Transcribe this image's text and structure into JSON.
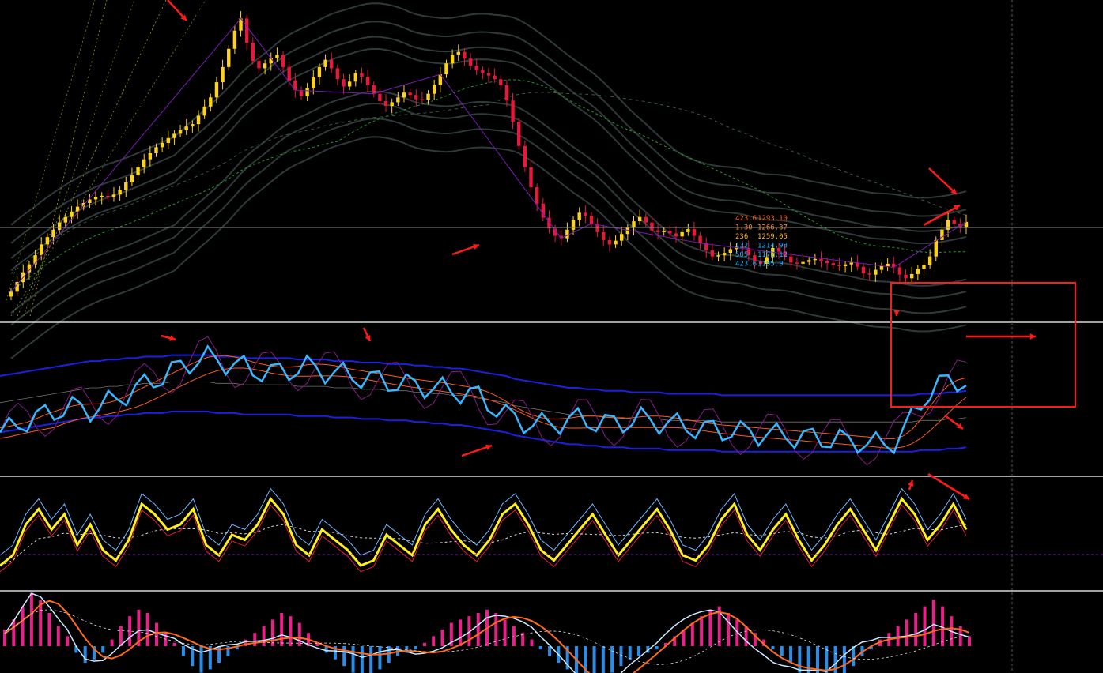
{
  "colors": {
    "background": "#000000",
    "bull_candle": "#ffd21a",
    "bear_candle": "#e8183c",
    "envelope": "#2e3a3a",
    "mid_dash": "#1e9a2a",
    "panel_divider": "#d8d8d8",
    "crosshair": "#9a9a9a",
    "rsi_main": "#38b6ff",
    "rsi_band": "#1a20e0",
    "rsi_slow": "#ff5a1a",
    "kd_main": "#ffef1a",
    "macd_pos": "#e8208a",
    "macd_neg": "#2a8ee8",
    "annotation": "#ff1a1a",
    "zigzag": "#7a1ab4"
  },
  "price_panel": {
    "labels": [
      {
        "text": "423.6",
        "color": "#ff6a1a"
      },
      {
        "text": "1293.10",
        "color": "#ff6a1a"
      },
      {
        "text": "1.30",
        "color": "#ff8a3a"
      },
      {
        "text": "1266.37",
        "color": "#ff8a3a"
      },
      {
        "text": "236",
        "color": "#ffb01a"
      },
      {
        "text": "1259.05",
        "color": "#ffb01a"
      },
      {
        "text": "132",
        "color": "#1ab0ff"
      },
      {
        "text": "1214.98",
        "color": "#1ab0ff"
      },
      {
        "text": "505",
        "color": "#1ab0ff"
      },
      {
        "text": "1172.12",
        "color": "#1ab0ff"
      },
      {
        "text": "423.6",
        "color": "#1ab0ff"
      },
      {
        "text": "1155.9",
        "color": "#1ab0ff"
      }
    ]
  },
  "chart_data": [
    {
      "type": "candlestick",
      "panel": "price",
      "title": "",
      "close": [
        1180,
        1196,
        1212,
        1225,
        1240,
        1258,
        1270,
        1282,
        1294,
        1303,
        1312,
        1320,
        1326,
        1332,
        1336,
        1338,
        1336,
        1340,
        1348,
        1360,
        1372,
        1385,
        1398,
        1408,
        1418,
        1425,
        1433,
        1440,
        1446,
        1452,
        1456,
        1470,
        1485,
        1500,
        1525,
        1550,
        1580,
        1610,
        1630,
        1590,
        1560,
        1548,
        1556,
        1565,
        1570,
        1550,
        1528,
        1512,
        1502,
        1515,
        1533,
        1550,
        1562,
        1548,
        1530,
        1518,
        1526,
        1540,
        1534,
        1520,
        1506,
        1494,
        1486,
        1492,
        1500,
        1508,
        1504,
        1497,
        1496,
        1506,
        1520,
        1538,
        1556,
        1570,
        1575,
        1564,
        1552,
        1545,
        1540,
        1536,
        1530,
        1520,
        1495,
        1460,
        1420,
        1385,
        1352,
        1325,
        1302,
        1284,
        1272,
        1268,
        1282,
        1298,
        1310,
        1305,
        1292,
        1278,
        1265,
        1258,
        1264,
        1275,
        1285,
        1296,
        1303,
        1294,
        1281,
        1278,
        1280,
        1276,
        1271,
        1278,
        1283,
        1272,
        1260,
        1248,
        1238,
        1240,
        1244,
        1250,
        1254,
        1252,
        1240,
        1229,
        1226,
        1237,
        1252,
        1246,
        1238,
        1228,
        1226,
        1229,
        1232,
        1234,
        1230,
        1227,
        1224,
        1222,
        1225,
        1228,
        1221,
        1210,
        1208,
        1216,
        1222,
        1226,
        1220,
        1208,
        1202,
        1209,
        1218,
        1224,
        1238,
        1265,
        1282,
        1298,
        1292,
        1285,
        1295
      ],
      "open": [
        1172,
        1180,
        1196,
        1212,
        1225,
        1240,
        1258,
        1270,
        1282,
        1294,
        1303,
        1312,
        1320,
        1326,
        1332,
        1336,
        1338,
        1336,
        1340,
        1348,
        1360,
        1372,
        1385,
        1398,
        1408,
        1418,
        1425,
        1433,
        1440,
        1446,
        1452,
        1456,
        1470,
        1485,
        1500,
        1525,
        1550,
        1580,
        1610,
        1630,
        1590,
        1560,
        1548,
        1556,
        1565,
        1570,
        1550,
        1528,
        1512,
        1502,
        1515,
        1533,
        1550,
        1562,
        1548,
        1530,
        1518,
        1526,
        1540,
        1534,
        1520,
        1506,
        1494,
        1486,
        1492,
        1500,
        1508,
        1504,
        1497,
        1496,
        1506,
        1520,
        1538,
        1556,
        1570,
        1575,
        1564,
        1552,
        1545,
        1540,
        1536,
        1530,
        1520,
        1495,
        1460,
        1420,
        1385,
        1352,
        1325,
        1302,
        1284,
        1272,
        1268,
        1282,
        1298,
        1310,
        1305,
        1292,
        1278,
        1265,
        1258,
        1264,
        1275,
        1285,
        1296,
        1303,
        1294,
        1281,
        1278,
        1280,
        1276,
        1271,
        1278,
        1283,
        1272,
        1260,
        1248,
        1238,
        1240,
        1244,
        1250,
        1254,
        1252,
        1240,
        1229,
        1226,
        1237,
        1252,
        1246,
        1238,
        1228,
        1226,
        1229,
        1232,
        1234,
        1230,
        1227,
        1224,
        1222,
        1225,
        1228,
        1221,
        1210,
        1208,
        1216,
        1222,
        1226,
        1220,
        1208,
        1202,
        1209,
        1218,
        1224,
        1238,
        1265,
        1282,
        1298,
        1292,
        1285
      ]
    },
    {
      "type": "line",
      "panel": "rsi",
      "series": [
        {
          "values": [
            28,
            30,
            33,
            36,
            38,
            40,
            42,
            44,
            45,
            44,
            43,
            45,
            48,
            51,
            54,
            57,
            60,
            63,
            66,
            69,
            72,
            75,
            77,
            78,
            77,
            75,
            73,
            72,
            70,
            69,
            68,
            69,
            70,
            71,
            72,
            71,
            69,
            68,
            67,
            66,
            65,
            64,
            63,
            62,
            61,
            60,
            60,
            59,
            58,
            57,
            56,
            55,
            54,
            52,
            48,
            44,
            40,
            37,
            35,
            34,
            33,
            34,
            35,
            36,
            37,
            36,
            35,
            34,
            34,
            35,
            36,
            37,
            36,
            35,
            34,
            33,
            32,
            31,
            30,
            30,
            29,
            29,
            28,
            28,
            27,
            27,
            26,
            26,
            25,
            25,
            24,
            24,
            23,
            23,
            22,
            22,
            21,
            20,
            20,
            22,
            28,
            38,
            48,
            56,
            60,
            62,
            63,
            62
          ]
        },
        {
          "values": [
            48,
            49,
            50,
            51,
            52,
            53,
            54,
            55,
            56,
            57,
            58,
            58,
            59,
            59,
            60,
            60,
            61,
            61,
            61,
            62,
            62,
            62,
            62,
            62,
            61,
            61,
            61,
            60,
            60,
            60,
            60,
            60,
            60,
            59,
            59,
            59,
            59,
            58,
            58,
            58,
            57,
            57,
            57,
            56,
            56,
            56,
            55,
            55,
            54,
            54,
            53,
            53,
            52,
            51,
            50,
            49,
            48,
            46,
            45,
            44,
            43,
            42,
            41,
            40,
            40,
            39,
            39,
            38,
            38,
            38,
            37,
            37,
            37,
            37,
            36,
            36,
            36,
            36,
            36,
            36,
            35,
            35,
            35,
            35,
            35,
            35,
            35,
            35,
            35,
            35,
            35,
            35,
            35,
            35,
            35,
            35,
            35,
            35,
            35,
            35,
            35,
            35,
            36,
            36,
            36,
            37,
            37,
            38
          ]
        }
      ]
    },
    {
      "type": "line",
      "panel": "kd",
      "series": [
        {
          "values": [
            20,
            30,
            60,
            75,
            55,
            70,
            40,
            60,
            35,
            25,
            45,
            80,
            70,
            55,
            60,
            75,
            40,
            30,
            50,
            45,
            60,
            85,
            70,
            40,
            30,
            55,
            45,
            35,
            20,
            25,
            50,
            40,
            30,
            60,
            75,
            55,
            40,
            30,
            45,
            70,
            80,
            60,
            35,
            25,
            40,
            55,
            70,
            50,
            30,
            45,
            60,
            75,
            55,
            30,
            25,
            40,
            65,
            80,
            50,
            35,
            55,
            70,
            45,
            25,
            40,
            60,
            75,
            55,
            35,
            60,
            85,
            70,
            45,
            60,
            80,
            55
          ]
        }
      ]
    },
    {
      "type": "bar",
      "panel": "macd",
      "values": [
        5,
        8,
        12,
        16,
        14,
        10,
        6,
        3,
        -2,
        -5,
        -4,
        -2,
        2,
        6,
        9,
        11,
        10,
        7,
        4,
        1,
        -3,
        -6,
        -8,
        -7,
        -5,
        -3,
        -1,
        2,
        4,
        6,
        8,
        10,
        9,
        7,
        4,
        1,
        -2,
        -4,
        -6,
        -8,
        -10,
        -9,
        -7,
        -5,
        -3,
        -2,
        -1,
        1,
        3,
        5,
        7,
        8,
        9,
        10,
        11,
        10,
        8,
        6,
        4,
        2,
        -1,
        -3,
        -5,
        -7,
        -9,
        -11,
        -12,
        -10,
        -8,
        -6,
        -4,
        -3,
        -2,
        -1,
        1,
        3,
        5,
        7,
        9,
        11,
        12,
        10,
        8,
        6,
        4,
        2,
        -1,
        -3,
        -5,
        -8,
        -10,
        -12,
        -14,
        -12,
        -9,
        -6,
        -3,
        -1,
        2,
        4,
        6,
        8,
        10,
        12,
        14,
        12,
        9,
        6,
        3
      ]
    }
  ],
  "annotations": {
    "box": {
      "label": ""
    },
    "arrow_count": 12
  }
}
